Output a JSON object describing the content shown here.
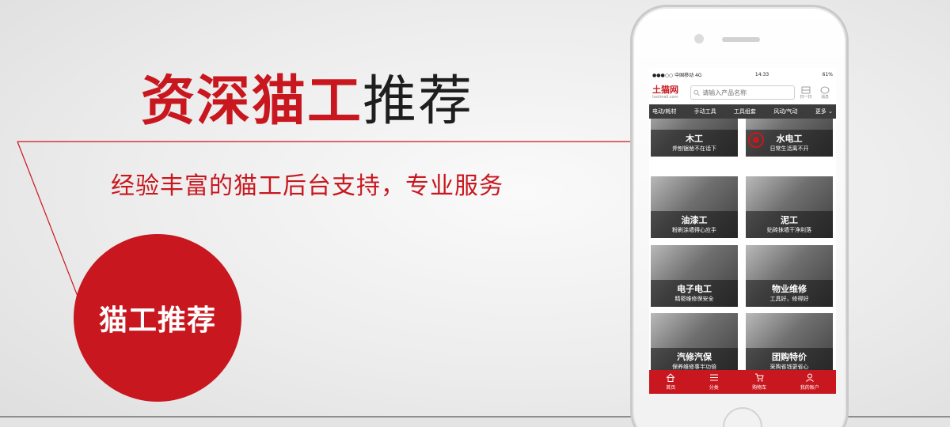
{
  "headline": {
    "red_part": "资深猫工",
    "dark_part": "推荐"
  },
  "subtitle": "经验丰富的猫工后台支持，专业服务",
  "badge_label": "猫工推荐",
  "colors": {
    "accent": "#c8171e",
    "dark": "#1e1e1e",
    "catbar": "#3c3c3c"
  },
  "phone": {
    "status": {
      "carrier": "●●●○○ 中国移动  4G",
      "time": "14:33",
      "battery": "61%"
    },
    "header": {
      "logo": "土猫网",
      "logo_sub": "toolmall.com",
      "search_placeholder": "请输入产品名称",
      "scan_label": "扫一扫",
      "message_label": "消息"
    },
    "categories": [
      "电动/耗材",
      "手动工具",
      "工具组套",
      "风动/气动",
      "更多"
    ],
    "cards": [
      {
        "title": "木工",
        "subtitle": "斧刨锯凿不在话下"
      },
      {
        "title": "水电工",
        "subtitle": "日常生活离不开"
      },
      {
        "title": "油漆工",
        "subtitle": "粉刷涂墙得心应手"
      },
      {
        "title": "泥工",
        "subtitle": "贴砖抹墙干净利落"
      },
      {
        "title": "电子电工",
        "subtitle": "精密维修保安全"
      },
      {
        "title": "物业维修",
        "subtitle": "工具好，修得好"
      },
      {
        "title": "汽修汽保",
        "subtitle": "保养维修事半功倍"
      },
      {
        "title": "团购特价",
        "subtitle": "采购省钱更省心"
      }
    ],
    "tabs": [
      {
        "label": "首页",
        "icon": "home-icon"
      },
      {
        "label": "分类",
        "icon": "list-icon"
      },
      {
        "label": "购物车",
        "icon": "cart-icon"
      },
      {
        "label": "我的账户",
        "icon": "user-icon"
      }
    ]
  }
}
